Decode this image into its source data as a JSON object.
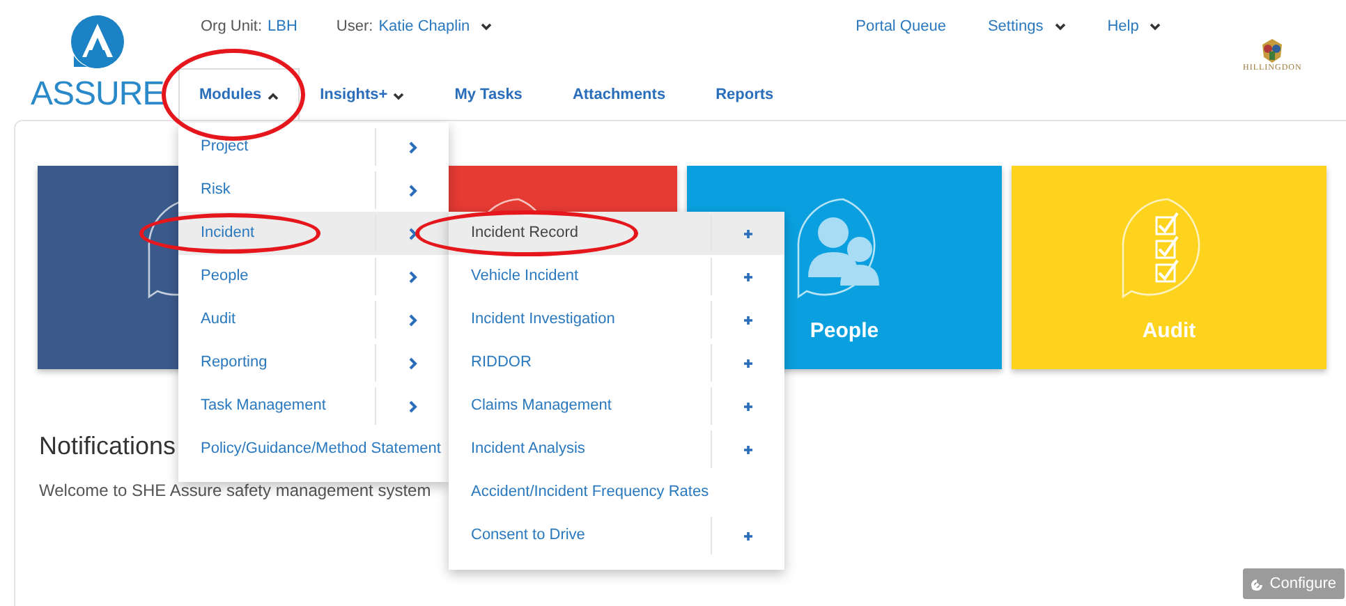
{
  "header": {
    "org_unit": {
      "label": "Org Unit:",
      "value": "LBH"
    },
    "user": {
      "label": "User:",
      "value": "Katie Chaplin"
    },
    "logo": {
      "text": "ASSURE"
    },
    "top_links": [
      {
        "label": "Portal Queue",
        "dropdown": false
      },
      {
        "label": "Settings",
        "dropdown": true
      },
      {
        "label": "Help",
        "dropdown": true
      }
    ],
    "council_logo": {
      "text": "HILLINGDON"
    },
    "nav": [
      {
        "label": "Modules",
        "dropdown": true,
        "expanded": true,
        "circled": true
      },
      {
        "label": "Insights+",
        "dropdown": true,
        "expanded": false,
        "circled": false
      },
      {
        "label": "My Tasks",
        "dropdown": false,
        "expanded": false,
        "circled": false
      },
      {
        "label": "Attachments",
        "dropdown": false,
        "expanded": false,
        "circled": false
      },
      {
        "label": "Reports",
        "dropdown": false,
        "expanded": false,
        "circled": false
      }
    ]
  },
  "modules_menu": [
    {
      "label": "Project",
      "selected": false,
      "circled": false,
      "submenu": true
    },
    {
      "label": "Risk",
      "selected": false,
      "circled": false,
      "submenu": true
    },
    {
      "label": "Incident",
      "selected": true,
      "circled": true,
      "submenu": true
    },
    {
      "label": "People",
      "selected": false,
      "circled": false,
      "submenu": true
    },
    {
      "label": "Audit",
      "selected": false,
      "circled": false,
      "submenu": true
    },
    {
      "label": "Reporting",
      "selected": false,
      "circled": false,
      "submenu": true
    },
    {
      "label": "Task Management",
      "selected": false,
      "circled": false,
      "submenu": true
    },
    {
      "label": "Policy/Guidance/Method Statement",
      "selected": false,
      "circled": false,
      "submenu": false
    }
  ],
  "incident_menu": [
    {
      "label": "Incident Record",
      "selected": true,
      "circled": true,
      "add": true
    },
    {
      "label": "Vehicle Incident",
      "selected": false,
      "circled": false,
      "add": true
    },
    {
      "label": "Incident Investigation",
      "selected": false,
      "circled": false,
      "add": true
    },
    {
      "label": "RIDDOR",
      "selected": false,
      "circled": false,
      "add": true
    },
    {
      "label": "Claims Management",
      "selected": false,
      "circled": false,
      "add": true
    },
    {
      "label": "Incident Analysis",
      "selected": false,
      "circled": false,
      "add": true
    },
    {
      "label": "Accident/Incident Frequency Rates",
      "selected": false,
      "circled": false,
      "add": false
    },
    {
      "label": "Consent to Drive",
      "selected": false,
      "circled": false,
      "add": true
    }
  ],
  "tiles": [
    {
      "kind": "blank",
      "color": "#3b5a8c"
    },
    {
      "kind": "blank",
      "color": "#e53b33"
    },
    {
      "kind": "people",
      "color": "#0aa0df",
      "label": "People"
    },
    {
      "kind": "audit",
      "color": "#fdd31e",
      "label": "Audit"
    }
  ],
  "notifications": {
    "title": "Notifications",
    "text": "Welcome to SHE Assure safety management system"
  },
  "configure_button": {
    "label": "Configure"
  }
}
